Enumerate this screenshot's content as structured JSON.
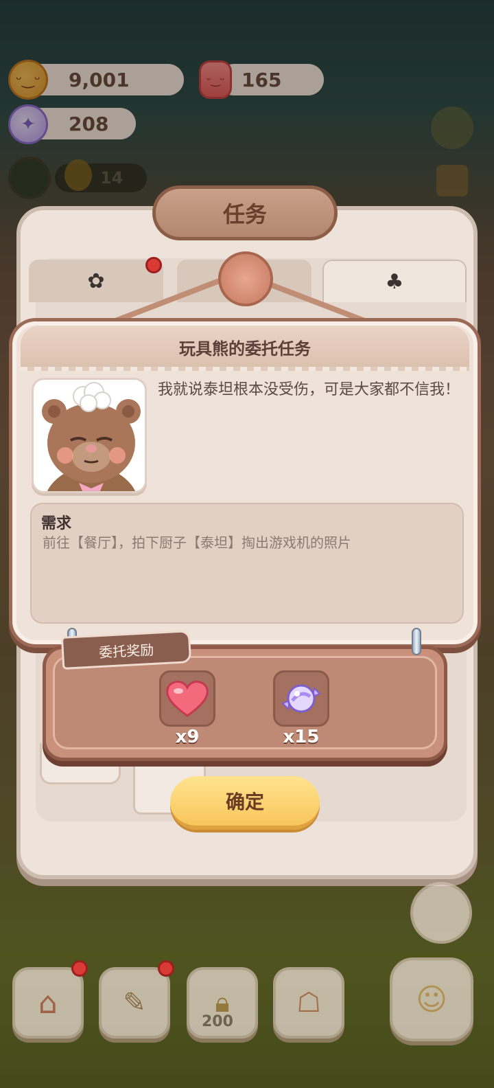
{
  "currencies": {
    "coins": "9,001",
    "jars": "165",
    "candies": "208",
    "level_count": "14"
  },
  "panel": {
    "title": "任务",
    "tabs": [
      {
        "icon": "paw-badge-icon"
      },
      {
        "icon": "bow-icon"
      },
      {
        "icon": "bear-silhouette-icon"
      }
    ]
  },
  "dialog": {
    "title": "玩具熊的委托任务",
    "speech": "我就说泰坦根本没受伤，可是大家都不信我！",
    "requirement_title": "需求",
    "requirement_text": "前往【餐厅】，拍下厨子【泰坦】掏出游戏机的照片"
  },
  "reward": {
    "label": "委托奖励",
    "items": [
      {
        "icon": "heart-icon",
        "count": "x9"
      },
      {
        "icon": "candy-icon",
        "count": "x15"
      }
    ]
  },
  "confirm_label": "确定",
  "bottom_bar": {
    "lock_price": "200"
  },
  "colors": {
    "accent": "#f8c65c",
    "panel": "#eee3da",
    "reward": "#c9907c",
    "title_plate": "#b3876f"
  }
}
